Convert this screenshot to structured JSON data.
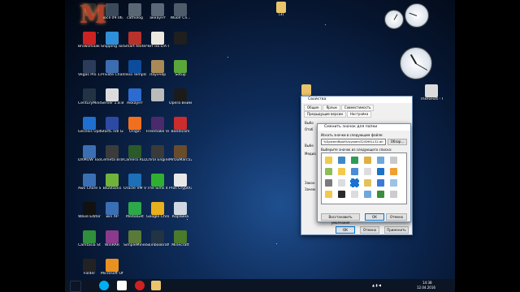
{
  "desktop": {
    "logo_letter": "M",
    "icons": [
      {
        "label": "",
        "color": "#2a2a2a"
      },
      {
        "label": "люся 09.06.2015",
        "color": "#3b4a5b"
      },
      {
        "label": "catholog",
        "color": "#596673"
      },
      {
        "label": "аккаунт",
        "color": "#5a6877"
      },
      {
        "label": "Wuolr Cli...",
        "color": "#4d5b6a"
      },
      {
        "label": "Browsmaak - Yandex",
        "color": "#cc2222"
      },
      {
        "label": "Snipping Tool",
        "color": "#2f8fd8"
      },
      {
        "label": "Smart texter Maker",
        "color": "#b8322b"
      },
      {
        "label": "Чит на LTA 0.3e",
        "color": "#ece8e0"
      },
      {
        "label": "",
        "color": "#1f1f1f"
      },
      {
        "label": "Vegas Pro 13.0 (64-bit)",
        "color": "#2b3b5a"
      },
      {
        "label": "Private Character...",
        "color": "#3c6db0"
      },
      {
        "label": "Inkio Template...",
        "color": "#0d4c9c"
      },
      {
        "label": "Лаунчер",
        "color": "#a88a57"
      },
      {
        "label": "Setup",
        "color": "#5aa63a"
      },
      {
        "label": "CenturyMine",
        "color": "#223344"
      },
      {
        "label": "Server 1.8.8",
        "color": "#dcdcdc"
      },
      {
        "label": "Аккаунт",
        "color": "#2d6bcf"
      },
      {
        "label": "",
        "color": "#bbbbbb"
      },
      {
        "label": "Opera Bнимбл...",
        "color": "#1b1b1b"
      },
      {
        "label": "Gecesis Update...",
        "color": "#1f6fd0"
      },
      {
        "label": "StartL ndl Gmarusk...",
        "color": "#2c4aa3"
      },
      {
        "label": "Origin",
        "color": "#f07020"
      },
      {
        "label": "Freemake Video C...",
        "color": "#4a2a6a"
      },
      {
        "label": "Bandicam",
        "color": "#cc2c2c"
      },
      {
        "label": "DXMOW Tools Pro",
        "color": "#3a6fb3"
      },
      {
        "label": "Cemeta Bravil V.0.9",
        "color": "#3b3b3b"
      },
      {
        "label": "Camera RLD",
        "color": "#2a5a2a"
      },
      {
        "label": "Chrol Engine",
        "color": "#3a3a3a"
      },
      {
        "label": "MrOuMarc52",
        "color": "#6a4b2a"
      },
      {
        "label": "Aws Chore Sarivae",
        "color": "#3a6fb3"
      },
      {
        "label": "BluStacks",
        "color": "#6fb33a"
      },
      {
        "label": "Oracle VM VirtualBox",
        "color": "#1d6fb8"
      },
      {
        "label": "The Sims 4",
        "color": "#30b030"
      },
      {
        "label": "Pros CryptXar...",
        "color": "#e8e8e8"
      },
      {
        "label": "Wave Editor",
        "color": "#111111"
      },
      {
        "label": "win XP",
        "color": "#3a6fb3"
      },
      {
        "label": "MediaGet",
        "color": "#2da84a"
      },
      {
        "label": "Google Chrome",
        "color": "#e8b01c"
      },
      {
        "label": "Корзина",
        "color": "#cfd8e0"
      },
      {
        "label": "Camtasia Studio 8",
        "color": "#2f8f3a"
      },
      {
        "label": "WinRAR",
        "color": "#8c3a8c"
      },
      {
        "label": "SimpleMinec...",
        "color": "#5a7a3a"
      },
      {
        "label": "Skinbookraft - Cholobold...",
        "color": "#223344"
      },
      {
        "label": "Minecraft",
        "color": "#4a7a2a"
      },
      {
        "label": "Folder",
        "color": "#222222"
      },
      {
        "label": "Microsoft Office",
        "color": "#e89020"
      }
    ],
    "top_folder_label": "(3)",
    "right_folder_labels": [
      "TheFaFatt - Unity",
      ""
    ]
  },
  "back_window": {
    "title": "Свойства",
    "tabs": [
      "Общие",
      "Ярлык",
      "Совместимость",
      "Предыдущие версии",
      "Настройка"
    ],
    "side_texts": [
      "Выбо",
      "Отоб",
      "Выбе",
      "Медиа",
      "Закон",
      "Зачем"
    ],
    "buttons": [
      "ОК",
      "Отмена",
      "Применить"
    ]
  },
  "dialog": {
    "title": "Сменить значок для папки",
    "path_label": "Искать значки в следующем файле:",
    "path_value": "%SystemRoot%\\system32\\SHELL32.dll",
    "browse_label": "Обзор...",
    "list_label": "Выберите значок из следующего списка:",
    "restore_label": "Восстановить умолчания",
    "ok_label": "ОК",
    "cancel_label": "Отмена"
  },
  "taskbar": {
    "time": "14:38",
    "date": "12.04.2016"
  },
  "colors": {
    "accent": "#0078d7",
    "taskbar": "#0b1524",
    "window_border": "#6d8fb8"
  }
}
